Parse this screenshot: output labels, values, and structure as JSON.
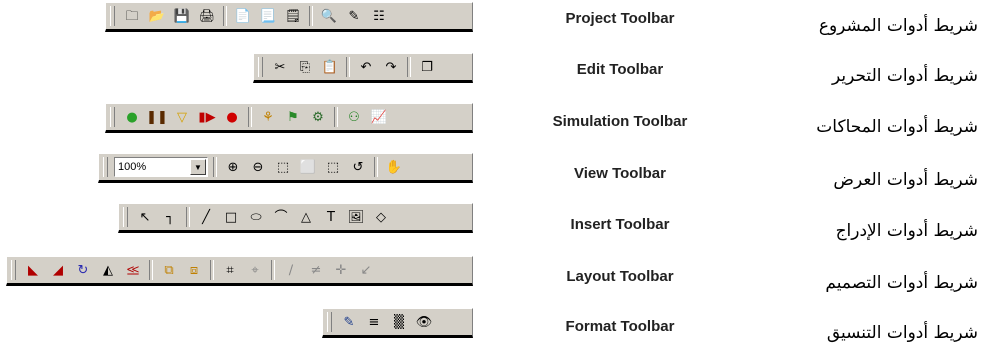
{
  "rows": [
    {
      "id": "project",
      "english": "Project Toolbar",
      "arabic": "شريط أدوات المشروع",
      "buttons": [
        {
          "name": "new-project-icon",
          "glyph": "🗀"
        },
        {
          "name": "open-project-icon",
          "glyph": "📂"
        },
        {
          "name": "save-icon",
          "glyph": "💾"
        },
        {
          "name": "print-icon",
          "glyph": "🖨"
        },
        {
          "name": "sep"
        },
        {
          "name": "schematic-sheet-icon",
          "glyph": "📄"
        },
        {
          "name": "pcb-sheet-icon",
          "glyph": "📃"
        },
        {
          "name": "report-sheet-icon",
          "glyph": "🗒"
        },
        {
          "name": "sep"
        },
        {
          "name": "preview-icon",
          "glyph": "🔍"
        },
        {
          "name": "design-check-icon",
          "glyph": "✎"
        },
        {
          "name": "netlist-icon",
          "glyph": "☷"
        }
      ]
    },
    {
      "id": "edit",
      "english": "Edit Toolbar",
      "arabic": "شريط أدوات التحرير",
      "buttons": [
        {
          "name": "cut-icon",
          "glyph": "✂"
        },
        {
          "name": "copy-icon",
          "glyph": "⎘"
        },
        {
          "name": "paste-icon",
          "glyph": "📋"
        },
        {
          "name": "sep"
        },
        {
          "name": "undo-icon",
          "glyph": "↶"
        },
        {
          "name": "redo-icon",
          "glyph": "↷"
        },
        {
          "name": "sep"
        },
        {
          "name": "properties-icon",
          "glyph": "❐"
        }
      ]
    },
    {
      "id": "simulation",
      "english": "Simulation Toolbar",
      "arabic": "شريط أدوات المحاكات",
      "buttons": [
        {
          "name": "run-icon",
          "glyph": "●",
          "color": "#2aa12a"
        },
        {
          "name": "pause-icon",
          "glyph": "❚❚",
          "color": "#5a2a00"
        },
        {
          "name": "step-icon",
          "glyph": "▽",
          "color": "#d4a000"
        },
        {
          "name": "step-into-icon",
          "glyph": "▮▶",
          "color": "#c00000"
        },
        {
          "name": "stop-icon",
          "glyph": "●",
          "color": "#d00000"
        },
        {
          "name": "sep"
        },
        {
          "name": "scope-icon",
          "glyph": "⚘",
          "color": "#c08000"
        },
        {
          "name": "probe-icon",
          "glyph": "⚑",
          "color": "#2a8a2a"
        },
        {
          "name": "analyzer-icon",
          "glyph": "⚙",
          "color": "#2a6a2a"
        },
        {
          "name": "sep"
        },
        {
          "name": "generator-icon",
          "glyph": "⚇",
          "color": "#208020"
        },
        {
          "name": "graph-icon",
          "glyph": "📈",
          "color": "#a00000"
        }
      ]
    },
    {
      "id": "view",
      "english": "View Toolbar",
      "arabic": "شريط أدوات العرض",
      "zoom": "100%",
      "buttons": [
        {
          "name": "zoom-in-icon",
          "glyph": "⊕"
        },
        {
          "name": "zoom-out-icon",
          "glyph": "⊖"
        },
        {
          "name": "zoom-area-icon",
          "glyph": "⬚"
        },
        {
          "name": "zoom-fit-icon",
          "glyph": "⬜"
        },
        {
          "name": "zoom-selection-icon",
          "glyph": "⬚"
        },
        {
          "name": "zoom-previous-icon",
          "glyph": "↺"
        },
        {
          "name": "sep"
        },
        {
          "name": "pan-hand-icon",
          "glyph": "✋"
        }
      ]
    },
    {
      "id": "insert",
      "english": "Insert Toolbar",
      "arabic": "شريط أدوات الإدراج",
      "buttons": [
        {
          "name": "select-arrow-icon",
          "glyph": "↖"
        },
        {
          "name": "wire-icon",
          "glyph": "┐"
        },
        {
          "name": "sep"
        },
        {
          "name": "line-icon",
          "glyph": "╱"
        },
        {
          "name": "rectangle-icon",
          "glyph": "□"
        },
        {
          "name": "ellipse-icon",
          "glyph": "⬭"
        },
        {
          "name": "arc-icon",
          "glyph": "⌒"
        },
        {
          "name": "polygon-icon",
          "glyph": "△"
        },
        {
          "name": "text-icon",
          "glyph": "T"
        },
        {
          "name": "picture-icon",
          "glyph": "🖼"
        },
        {
          "name": "bus-port-icon",
          "glyph": "◇"
        }
      ]
    },
    {
      "id": "layout",
      "english": "Layout Toolbar",
      "arabic": "شريط أدوات التصميم",
      "buttons": [
        {
          "name": "rotate-left-icon",
          "glyph": "◣",
          "color": "#b00000"
        },
        {
          "name": "rotate-right-icon",
          "glyph": "◢",
          "color": "#b00000"
        },
        {
          "name": "rotate-free-icon",
          "glyph": "↻",
          "color": "#2a2ab0"
        },
        {
          "name": "mirror-icon",
          "glyph": "◭"
        },
        {
          "name": "flip-icon",
          "glyph": "⪣",
          "color": "#b00000"
        },
        {
          "name": "sep"
        },
        {
          "name": "bring-front-icon",
          "glyph": "⧉",
          "color": "#c08000"
        },
        {
          "name": "send-back-icon",
          "glyph": "⧈",
          "color": "#c08000"
        },
        {
          "name": "sep"
        },
        {
          "name": "group-icon",
          "glyph": "⌗"
        },
        {
          "name": "ungroup-icon",
          "glyph": "⌖",
          "color": "#888"
        },
        {
          "name": "sep"
        },
        {
          "name": "connect-icon",
          "glyph": "∕",
          "color": "#888"
        },
        {
          "name": "disconnect-icon",
          "glyph": "≠",
          "color": "#888"
        },
        {
          "name": "junction-icon",
          "glyph": "✛",
          "color": "#888"
        },
        {
          "name": "pin-icon",
          "glyph": "↙",
          "color": "#888"
        }
      ]
    },
    {
      "id": "format",
      "english": "Format Toolbar",
      "arabic": "شريط أدوات التنسيق",
      "buttons": [
        {
          "name": "line-color-icon",
          "glyph": "✎",
          "color": "#1a3a8a"
        },
        {
          "name": "line-width-icon",
          "glyph": "≡"
        },
        {
          "name": "fill-pattern-icon",
          "glyph": "▒"
        },
        {
          "name": "visibility-eye-icon",
          "glyph": "👁"
        }
      ]
    }
  ]
}
